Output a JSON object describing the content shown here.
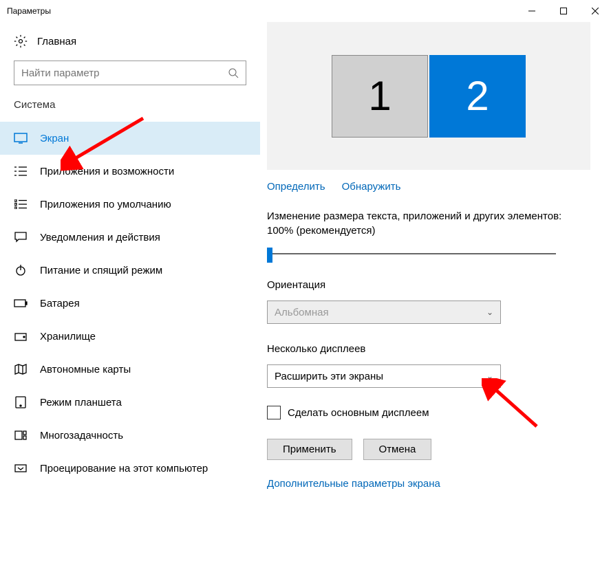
{
  "titlebar": {
    "title": "Параметры"
  },
  "sidebar": {
    "home": "Главная",
    "search_placeholder": "Найти параметр",
    "section": "Система",
    "items": [
      {
        "label": "Экран"
      },
      {
        "label": "Приложения и возможности"
      },
      {
        "label": "Приложения по умолчанию"
      },
      {
        "label": "Уведомления и действия"
      },
      {
        "label": "Питание и спящий режим"
      },
      {
        "label": "Батарея"
      },
      {
        "label": "Хранилище"
      },
      {
        "label": "Автономные карты"
      },
      {
        "label": "Режим планшета"
      },
      {
        "label": "Многозадачность"
      },
      {
        "label": "Проецирование на этот компьютер"
      }
    ]
  },
  "content": {
    "monitor1": "1",
    "monitor2": "2",
    "identify": "Определить",
    "detect": "Обнаружить",
    "scale_text": "Изменение размера текста, приложений и других элементов: 100% (рекомендуется)",
    "orientation_label": "Ориентация",
    "orientation_value": "Альбомная",
    "multi_label": "Несколько дисплеев",
    "multi_value": "Расширить эти экраны",
    "main_display": "Сделать основным дисплеем",
    "apply": "Применить",
    "cancel": "Отмена",
    "advanced": "Дополнительные параметры экрана"
  }
}
